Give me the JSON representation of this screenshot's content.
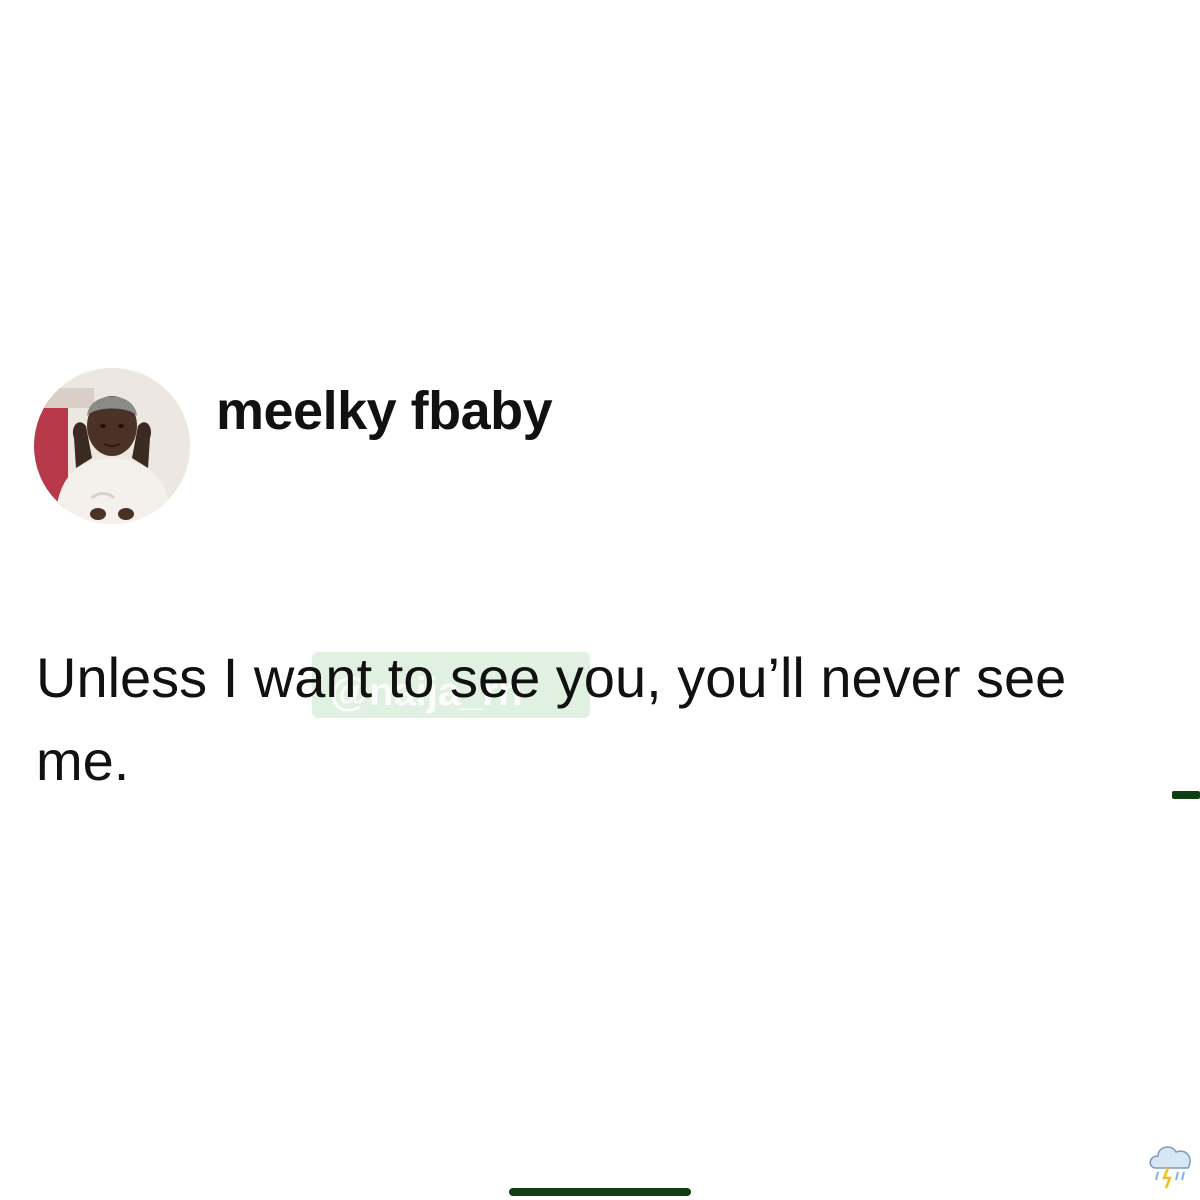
{
  "post": {
    "author": {
      "display_name": "meelky fbaby",
      "avatar_icon": "profile-photo"
    },
    "text": "Unless I want to see you, you’ll never see me."
  },
  "watermark": {
    "text": "@naija_rn"
  },
  "indicators": {
    "accent_color": "#0f3d14",
    "corner_icon": "storm-cloud-icon"
  }
}
